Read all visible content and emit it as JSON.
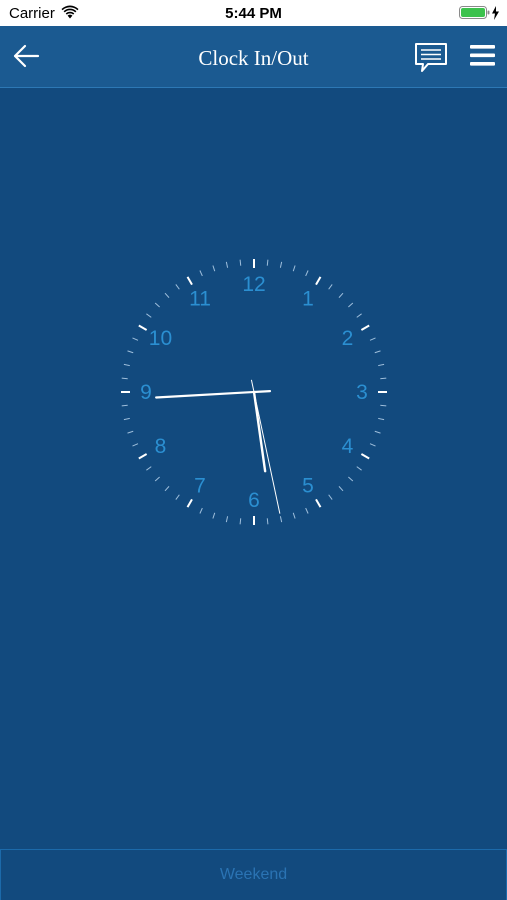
{
  "status_bar": {
    "carrier": "Carrier",
    "time": "5:44 PM",
    "wifi_icon": "wifi-icon",
    "battery_icon": "battery-charging-icon"
  },
  "nav": {
    "title": "Clock In/Out",
    "back_icon": "back-arrow-icon",
    "chat_icon": "chat-icon",
    "menu_icon": "hamburger-menu-icon"
  },
  "clock": {
    "numerals": [
      "12",
      "1",
      "2",
      "3",
      "4",
      "5",
      "6",
      "7",
      "8",
      "9",
      "10",
      "11"
    ],
    "time": {
      "hour": 5,
      "minute": 44,
      "second": 28
    },
    "numeral_color": "#2b8fd1",
    "hand_color": "#ffffff"
  },
  "footer": {
    "label": "Weekend"
  },
  "colors": {
    "background": "#124a7e",
    "nav_background": "#1b5a91",
    "footer_text": "#2a73b3"
  }
}
